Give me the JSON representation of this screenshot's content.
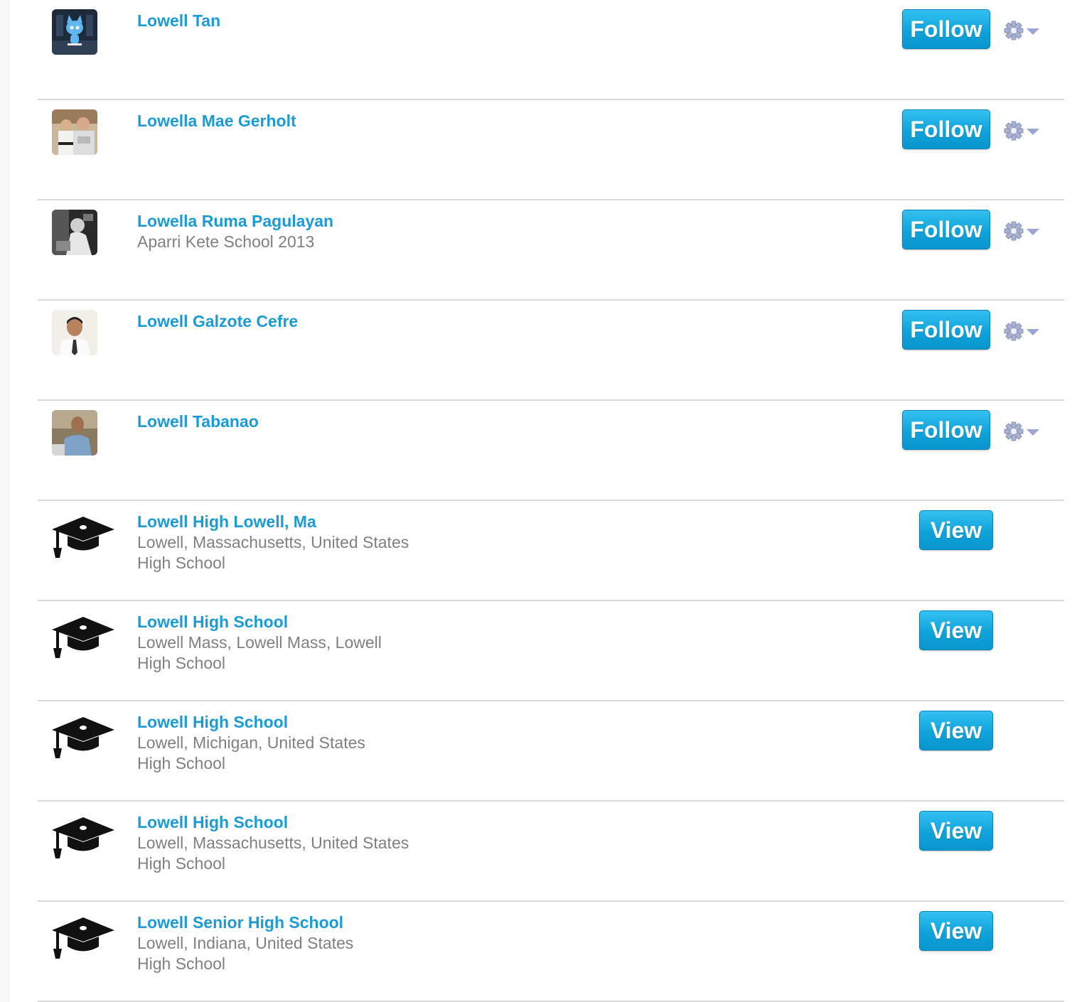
{
  "people": [
    {
      "name": "Lowell Tan",
      "subtitle": "",
      "follow_label": "Follow",
      "avatar": "anime-blue-cat"
    },
    {
      "name": "Lowella Mae Gerholt",
      "subtitle": "",
      "follow_label": "Follow",
      "avatar": "two-people-photo"
    },
    {
      "name": "Lowella Ruma Pagulayan",
      "subtitle": "Aparri Kete School 2013",
      "follow_label": "Follow",
      "avatar": "monochrome-photo"
    },
    {
      "name": "Lowell Galzote Cefre",
      "subtitle": "",
      "follow_label": "Follow",
      "avatar": "man-in-tie-photo"
    },
    {
      "name": "Lowell Tabanao",
      "subtitle": "",
      "follow_label": "Follow",
      "avatar": "man-at-desk-photo"
    }
  ],
  "schools": [
    {
      "name": "Lowell High Lowell, Ma",
      "location": "Lowell, Massachusetts, United States",
      "type": "High School",
      "view_label": "View"
    },
    {
      "name": "Lowell High School",
      "location": "Lowell Mass, Lowell Mass, Lowell",
      "type": "High School",
      "view_label": "View"
    },
    {
      "name": "Lowell High School",
      "location": "Lowell, Michigan, United States",
      "type": "High School",
      "view_label": "View"
    },
    {
      "name": "Lowell High School",
      "location": "Lowell, Massachusetts, United States",
      "type": "High School",
      "view_label": "View"
    },
    {
      "name": "Lowell Senior High School",
      "location": "Lowell, Indiana, United States",
      "type": "High School",
      "view_label": "View"
    }
  ],
  "icons": {
    "options": "gear-icon",
    "dropdown": "chevron-down-icon",
    "school": "graduation-cap-icon"
  },
  "colors": {
    "link": "#1a9bd7",
    "button": "#0fa3db",
    "subtext": "#808080",
    "divider": "#d9d9d9"
  }
}
